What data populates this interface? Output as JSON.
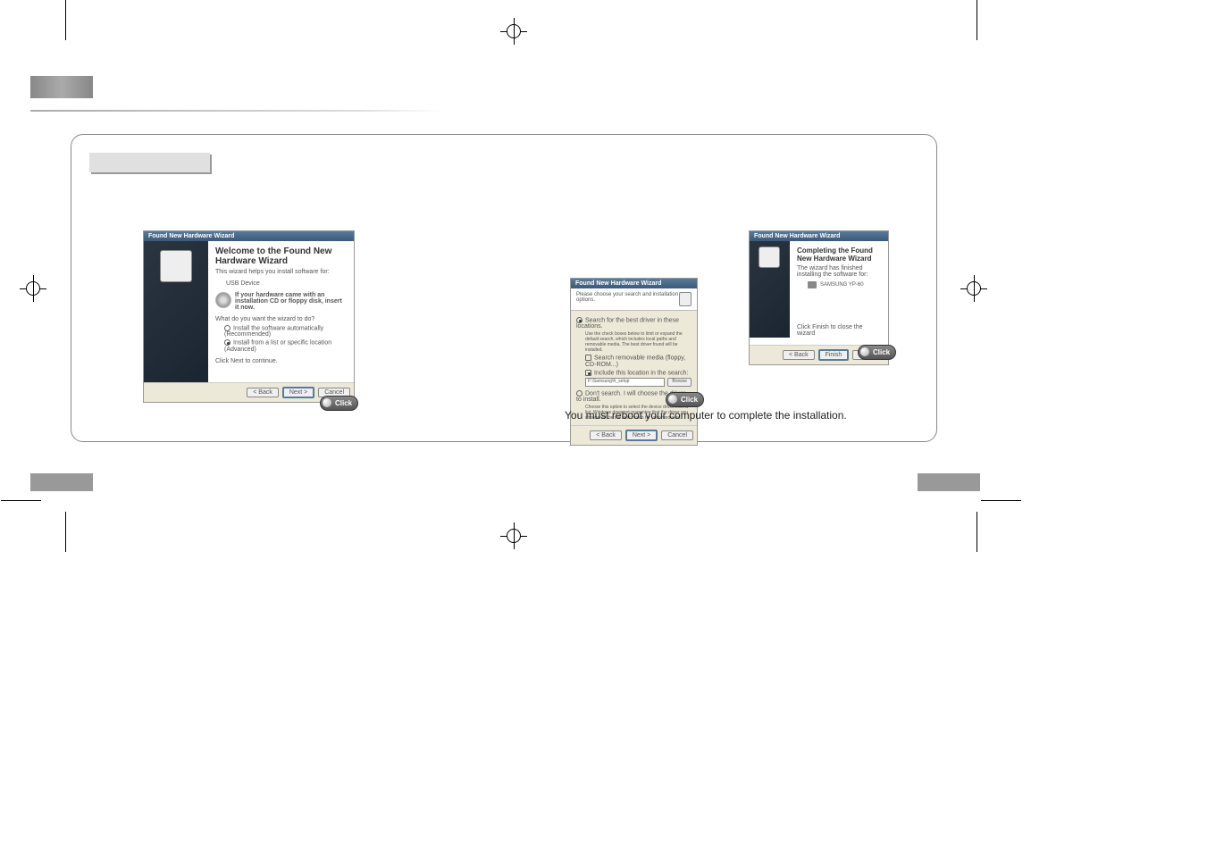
{
  "wizard1": {
    "title": "Found New Hardware Wizard",
    "heading": "Welcome to the Found New Hardware Wizard",
    "intro": "This wizard helps you install software for:",
    "device": "USB Device",
    "cd_hint": "If your hardware came with an installation CD or floppy disk, insert it now.",
    "question": "What do you want the wizard to do?",
    "opt_auto": "Install the software automatically (Recommended)",
    "opt_list": "Install from a list or specific location (Advanced)",
    "next_hint": "Click Next to continue.",
    "back": "< Back",
    "next": "Next >",
    "cancel": "Cancel"
  },
  "wizard2": {
    "title": "Found New Hardware Wizard",
    "header": "Please choose your search and installation options.",
    "opt_search": "Search for the best driver in these locations.",
    "search_desc": "Use the check boxes below to limit or expand the default search, which includes local paths and removable media. The best driver found will be installed.",
    "chk_removable": "Search removable media (floppy, CD-ROM...)",
    "chk_include": "Include this location in the search:",
    "path_value": "F:\\Samsung\\fr_setup",
    "browse": "Browse",
    "opt_dont": "Don't search. I will choose the driver to install.",
    "dont_desc": "Choose this option to select the device driver from a list. Windows does not guarantee that the driver you choose will be the best match for your hardware.",
    "back": "< Back",
    "next": "Next >",
    "cancel": "Cancel"
  },
  "wizard3": {
    "title": "Found New Hardware Wizard",
    "heading": "Completing the Found New Hardware Wizard",
    "intro": "The wizard has finished installing the software for:",
    "device": "SAMSUNG YP-60",
    "close_hint": "Click Finish to close the wizard",
    "back": "< Back",
    "finish": "Finish",
    "cancel": "Cancel"
  },
  "click_label": "Click",
  "reboot_note": "You must reboot your computer to complete the installation."
}
